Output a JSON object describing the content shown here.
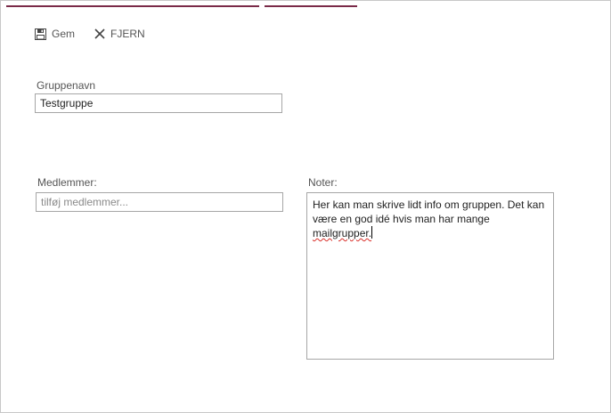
{
  "toolbar": {
    "save_label": "Gem",
    "remove_label": "FJERN"
  },
  "form": {
    "group_name_label": "Gruppenavn",
    "group_name_value": "Testgruppe",
    "members_label": "Medlemmer:",
    "members_placeholder": "tilføj medlemmer...",
    "notes_label": "Noter:",
    "notes_text_main": "Her kan man skrive lidt info om gruppen. Det kan være en god idé hvis man har mange ",
    "notes_text_misspelled": "mailgrupper."
  },
  "colors": {
    "tab_accent": "#7a2a48",
    "border": "#a6a6a6",
    "spellcheck": "#d9312b"
  },
  "icons": {
    "save": "floppy-disk-icon",
    "remove": "close-icon"
  }
}
